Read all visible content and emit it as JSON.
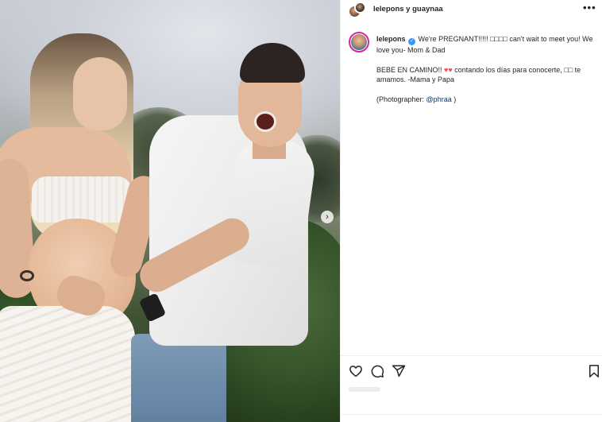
{
  "header": {
    "title": "lelepons y guaynaa",
    "more_icon": "more-horizontal-icon",
    "more_label": "•••"
  },
  "photo": {
    "description_icon": "photo",
    "next_label": "›",
    "next_icon": "chevron-right-icon"
  },
  "caption": {
    "username": "lelepons",
    "verified_icon": "verified-badge-icon",
    "verified_glyph": "✓",
    "line1": "We're PREGNANT!!!!! □□□□ can't wait to meet you! We love you- Mom & Dad",
    "line2_start": "BEBE EN CAMINO!! ",
    "hearts": "♥♥",
    "line2_end": " contando los días para conocerte, □□ te amamos. -Mama y Papa",
    "photographer_prefix": "(Photographer: ",
    "photographer_handle": "@phraa",
    "photographer_suffix": " )"
  },
  "actions": {
    "like_icon": "heart-icon",
    "comment_icon": "comment-icon",
    "share_icon": "send-icon",
    "save_icon": "bookmark-icon"
  },
  "colors": {
    "verified": "#3897f0",
    "hearts": "#ed4956",
    "mention": "#00376b",
    "text": "#262626"
  }
}
